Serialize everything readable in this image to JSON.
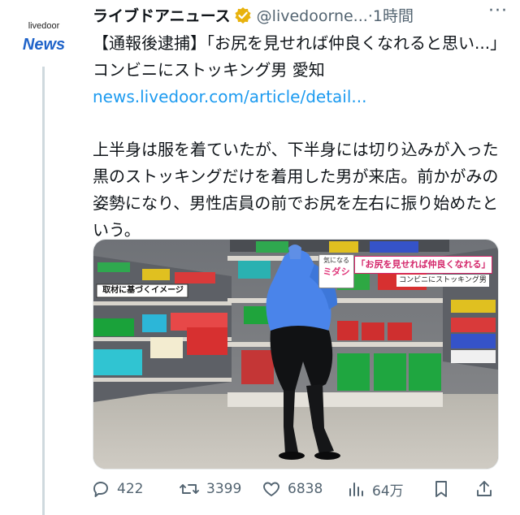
{
  "avatar": {
    "brand_small": "livedoor",
    "brand_big": "News"
  },
  "header": {
    "display_name": "ライブドアニュース",
    "handle": "@livedoorne...",
    "separator": "·",
    "time": "1時間",
    "more_label": "···"
  },
  "tweet": {
    "headline": "【通報後逮捕】「お尻を見せれば仲良くなれると思い...」コンビニにストッキング男 愛知",
    "link": "news.livedoor.com/article/detail...",
    "body": "上半身は服を着ていたが、下半身には切り込みが入った黒のストッキングだけを着用した男が来店。前かがみの姿勢になり、男性店員の前でお尻を左右に振り始めたという。"
  },
  "media": {
    "label_left": "取材に基づくイメージ",
    "banner_tag_top": "気になる",
    "banner_tag_bottom": "ミダシ",
    "banner_title": "「お尻を見せれば仲良くなれる」",
    "banner_sub": "コンビニにストッキング男"
  },
  "actions": {
    "replies": "422",
    "retweets": "3399",
    "likes": "6838",
    "views": "64万"
  },
  "colors": {
    "link": "#1d9bf0",
    "muted": "#536471",
    "verified": "#e8b20d",
    "brand": "#1f63c9"
  }
}
